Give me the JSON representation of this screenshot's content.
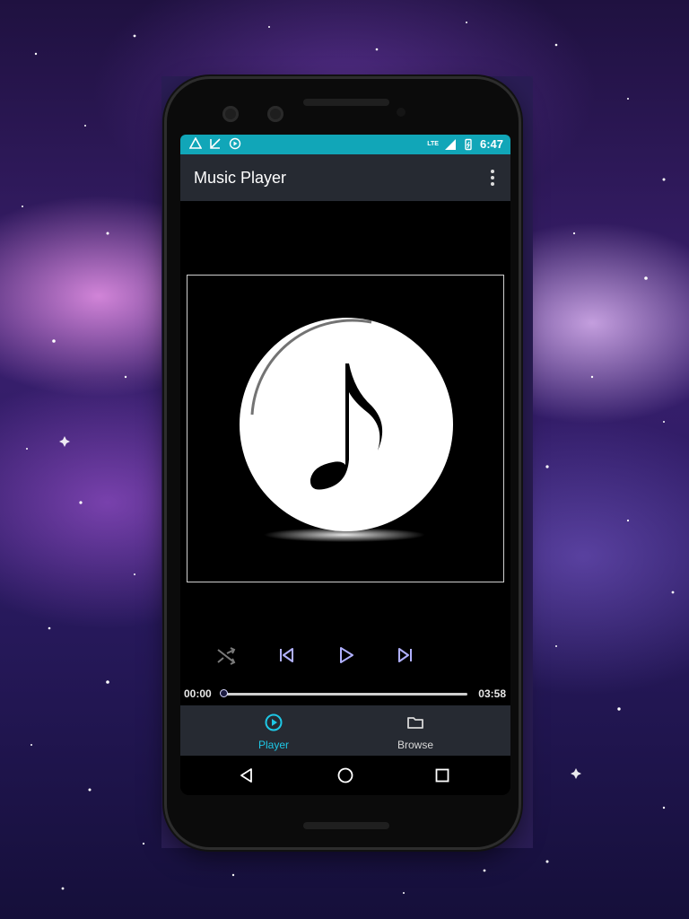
{
  "app": {
    "title": "Music Player"
  },
  "status_bar": {
    "time": "6:47",
    "network": "LTE"
  },
  "player": {
    "time_elapsed": "00:00",
    "time_total": "03:58",
    "progress": 0.0
  },
  "bottom_nav": {
    "items": [
      {
        "label": "Player",
        "icon": "play-circle-icon",
        "active": true
      },
      {
        "label": "Browse",
        "icon": "folder-icon",
        "active": false
      }
    ]
  },
  "colors": {
    "accent": "#1ec8e6",
    "status_bar": "#11a6b8",
    "app_bar": "#262a32"
  }
}
